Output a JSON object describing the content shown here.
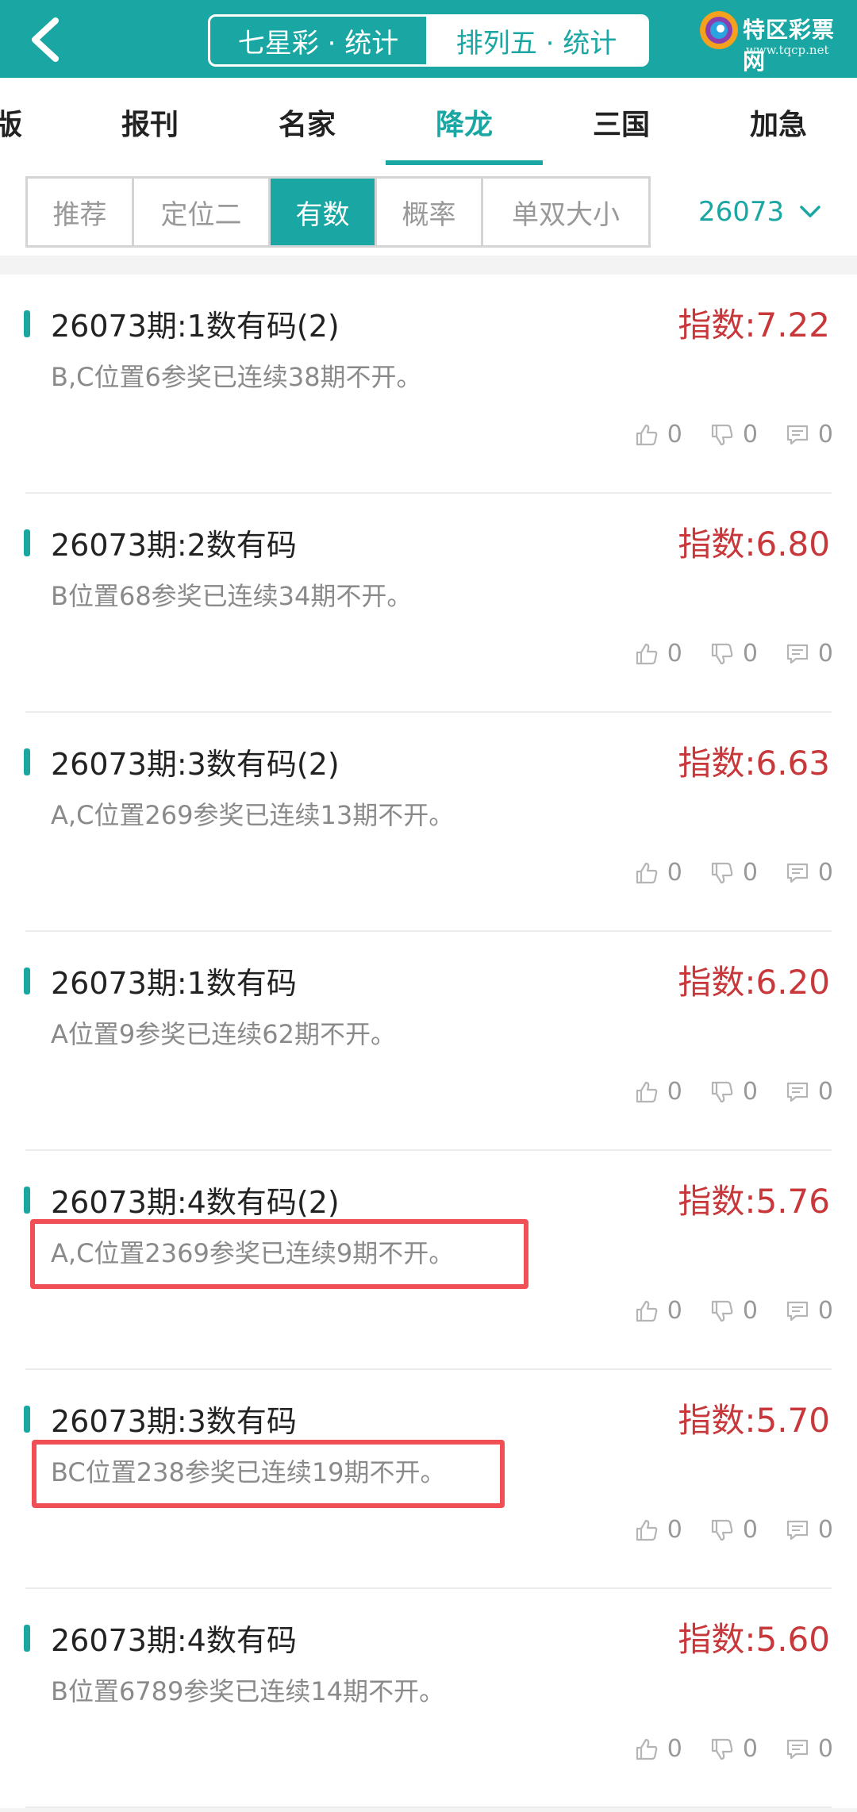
{
  "header": {
    "seg_left": "七星彩 · 统计",
    "seg_right": "排列五 · 统计",
    "brand_name": "特区彩票网",
    "brand_url": "www.tqcp.net"
  },
  "categories": [
    "版",
    "报刊",
    "名家",
    "降龙",
    "三国",
    "加急"
  ],
  "active_category": "降龙",
  "subtabs": [
    "推荐",
    "定位二",
    "有数",
    "概率",
    "单双大小"
  ],
  "active_subtab": "有数",
  "period": "26073",
  "items": [
    {
      "title": "26073期:1数有码(2)",
      "score": "指数:7.22",
      "desc": "B,C位置6参奖已连续38期不开。",
      "likes": "0",
      "dislikes": "0",
      "comments": "0"
    },
    {
      "title": "26073期:2数有码",
      "score": "指数:6.80",
      "desc": "B位置68参奖已连续34期不开。",
      "likes": "0",
      "dislikes": "0",
      "comments": "0"
    },
    {
      "title": "26073期:3数有码(2)",
      "score": "指数:6.63",
      "desc": "A,C位置269参奖已连续13期不开。",
      "likes": "0",
      "dislikes": "0",
      "comments": "0"
    },
    {
      "title": "26073期:1数有码",
      "score": "指数:6.20",
      "desc": "A位置9参奖已连续62期不开。",
      "likes": "0",
      "dislikes": "0",
      "comments": "0"
    },
    {
      "title": "26073期:4数有码(2)",
      "score": "指数:5.76",
      "desc": "A,C位置2369参奖已连续9期不开。",
      "likes": "0",
      "dislikes": "0",
      "comments": "0"
    },
    {
      "title": "26073期:3数有码",
      "score": "指数:5.70",
      "desc": "BC位置238参奖已连续19期不开。",
      "likes": "0",
      "dislikes": "0",
      "comments": "0"
    },
    {
      "title": "26073期:4数有码",
      "score": "指数:5.60",
      "desc": "B位置6789参奖已连续14期不开。",
      "likes": "0",
      "dislikes": "0",
      "comments": "0"
    }
  ],
  "colors": {
    "accent": "#1aa7a3",
    "score": "#c8383b",
    "highlight": "#ef4f55"
  }
}
